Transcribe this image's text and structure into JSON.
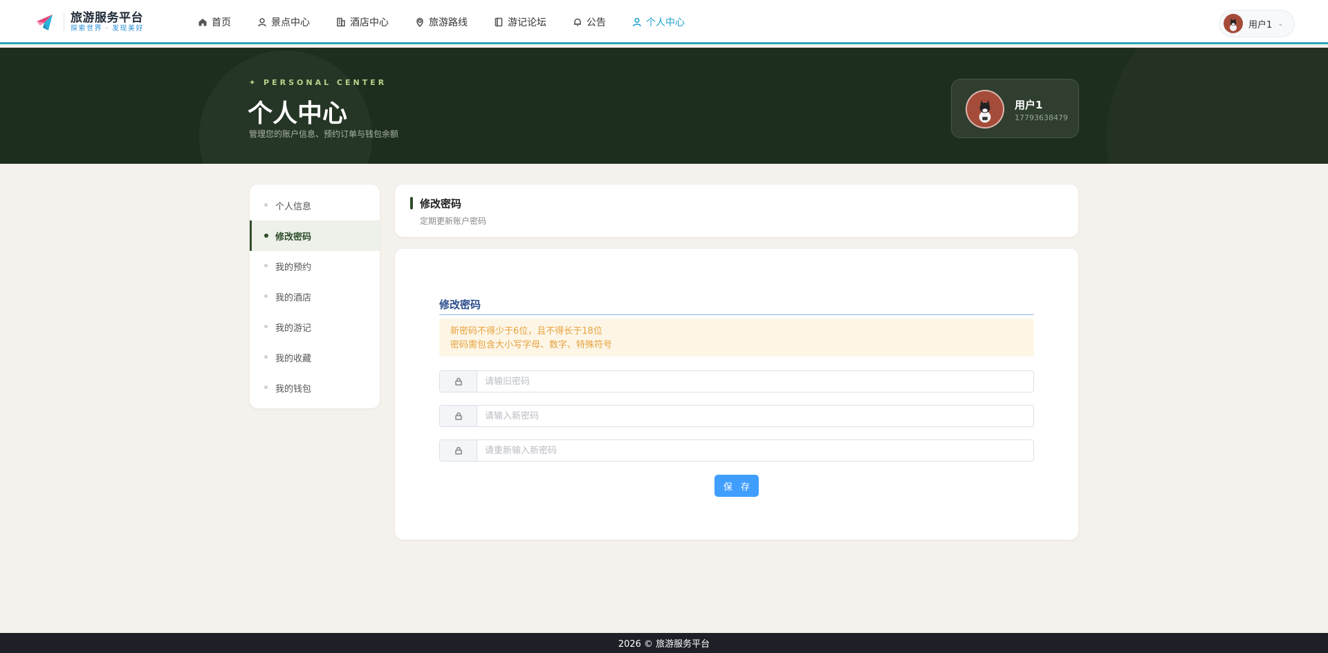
{
  "brand": {
    "name": "旅游服务平台",
    "slogan": "探索世界 · 发现美好"
  },
  "nav": {
    "items": [
      {
        "label": "首页",
        "icon": "home-icon"
      },
      {
        "label": "景点中心",
        "icon": "user-pin-icon"
      },
      {
        "label": "酒店中心",
        "icon": "building-icon"
      },
      {
        "label": "旅游路线",
        "icon": "route-icon"
      },
      {
        "label": "游记论坛",
        "icon": "notebook-icon"
      },
      {
        "label": "公告",
        "icon": "bell-icon"
      },
      {
        "label": "个人中心",
        "icon": "user-icon",
        "active": true
      }
    ],
    "active_color": "#1aa0cf"
  },
  "user": {
    "name": "用户1",
    "phone": "17793638479"
  },
  "hero": {
    "tag": "✦ PERSONAL CENTER",
    "title": "个人中心",
    "subtitle": "管理您的账户信息、预约订单与钱包余额"
  },
  "sidebar": {
    "items": [
      {
        "label": "个人信息"
      },
      {
        "label": "修改密码",
        "active": true
      },
      {
        "label": "我的预约"
      },
      {
        "label": "我的酒店"
      },
      {
        "label": "我的游记"
      },
      {
        "label": "我的收藏"
      },
      {
        "label": "我的钱包"
      }
    ]
  },
  "section": {
    "title": "修改密码",
    "subtitle": "定期更新账户密码"
  },
  "form": {
    "title": "修改密码",
    "tip_line1": "新密码不得少于6位，且不得长于18位",
    "tip_line2": "密码需包含大小写字母、数字、特殊符号",
    "old_password": {
      "value": "",
      "placeholder": "请输旧密码"
    },
    "new_password": {
      "value": "",
      "placeholder": "请输入新密码"
    },
    "confirm_password": {
      "value": "",
      "placeholder": "请重新输入新密码"
    },
    "save_label": "保 存"
  },
  "footer": {
    "text": "2026 © 旅游服务平台"
  },
  "colors": {
    "hero_bg": "#1e2e1e",
    "accent_green": "#2f4d2a",
    "primary_button": "#409eff",
    "tip_text": "#e6a23c"
  }
}
